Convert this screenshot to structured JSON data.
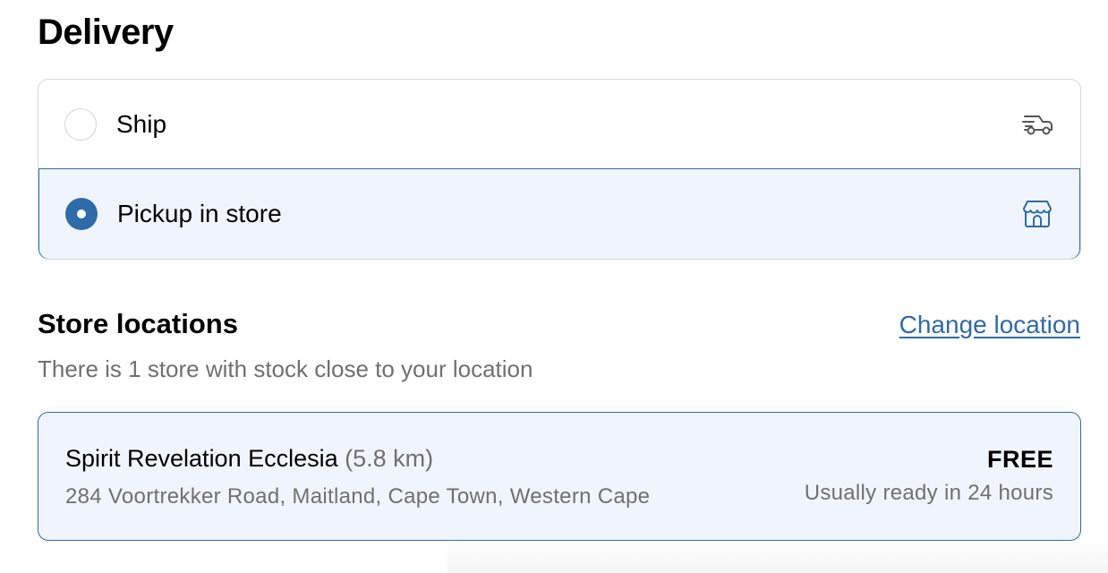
{
  "delivery": {
    "title": "Delivery",
    "options": [
      {
        "label": "Ship",
        "selected": false,
        "icon": "delivery-truck-icon"
      },
      {
        "label": "Pickup in store",
        "selected": true,
        "icon": "storefront-icon"
      }
    ]
  },
  "store_locations": {
    "heading": "Store locations",
    "change_link": "Change location",
    "subtitle": "There is 1 store with stock close to your location",
    "stores": [
      {
        "name": "Spirit Revelation Ecclesia",
        "distance": "(5.8 km)",
        "address": "284 Voortrekker Road, Maitland, Cape Town, Western Cape",
        "price": "FREE",
        "ready": "Usually ready in 24 hours"
      }
    ]
  },
  "colors": {
    "accent": "#2f6ba8",
    "selected_bg": "#f0f5fd",
    "muted_text": "#707070",
    "border": "#d9d9d9"
  }
}
